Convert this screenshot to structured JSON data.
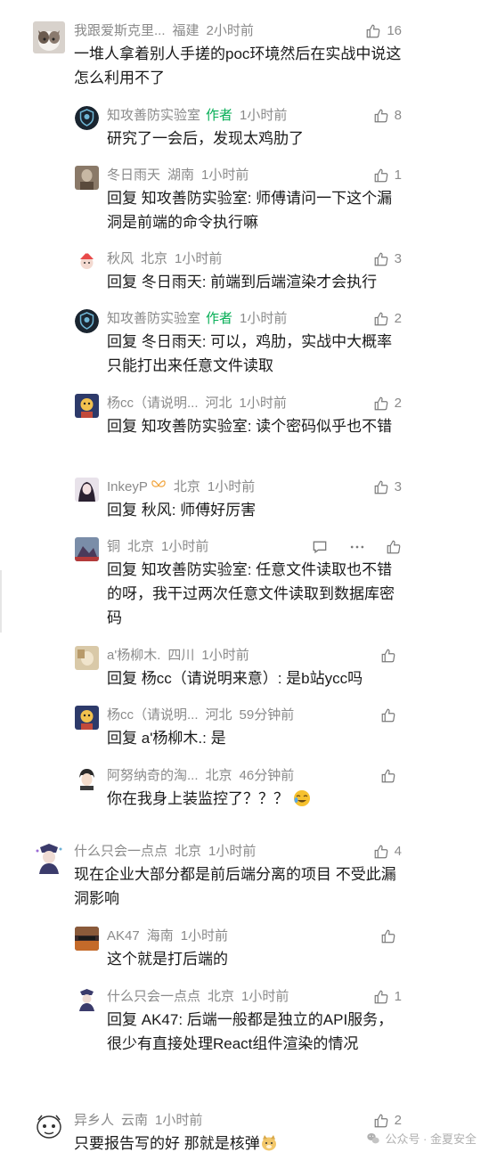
{
  "comments": [
    {
      "name": "我跟爱斯克里...",
      "author": "",
      "loc": "福建",
      "time": "2小时前",
      "likes": "16",
      "text": "一堆人拿着别人手搓的poc环境然后在实战中说这怎么利用不了"
    },
    {
      "name": "知攻善防实验室",
      "author": "作者",
      "loc": "",
      "time": "1小时前",
      "likes": "8",
      "text": "研究了一会后，发现太鸡肋了"
    },
    {
      "name": "冬日雨天",
      "author": "",
      "loc": "湖南",
      "time": "1小时前",
      "likes": "1",
      "prefix": "回复",
      "target": "知攻善防实验室",
      "text": ": 师傅请问一下这个漏洞是前端的命令执行嘛"
    },
    {
      "name": "秋风",
      "author": "",
      "loc": "北京",
      "time": "1小时前",
      "likes": "3",
      "prefix": "回复",
      "target": "冬日雨天",
      "text": ": 前端到后端渲染才会执行"
    },
    {
      "name": "知攻善防实验室",
      "author": "作者",
      "loc": "",
      "time": "1小时前",
      "likes": "2",
      "prefix": "回复",
      "target": "冬日雨天",
      "text": ": 可以，鸡肋，实战中大概率只能打出来任意文件读取"
    },
    {
      "name": "杨cc（请说明...",
      "author": "",
      "loc": "河北",
      "time": "1小时前",
      "likes": "2",
      "prefix": "回复",
      "target": "知攻善防实验室",
      "text": ": 读个密码似乎也不错"
    },
    {
      "name": "InkeyP",
      "author": "",
      "loc": "北京",
      "time": "1小时前",
      "likes": "3",
      "prefix": "回复",
      "target": "秋风",
      "text": ": 师傅好厉害"
    },
    {
      "name": "铜",
      "author": "",
      "loc": "北京",
      "time": "1小时前",
      "likes": "",
      "prefix": "回复",
      "target": "知攻善防实验室",
      "text": ": 任意文件读取也不错的呀，我干过两次任意文件读取到数据库密码"
    },
    {
      "name": "a'杨柳木.",
      "author": "",
      "loc": "四川",
      "time": "1小时前",
      "likes": "",
      "prefix": "回复",
      "target": "杨cc（请说明来意）",
      "text": ": 是b站ycc吗"
    },
    {
      "name": "杨cc（请说明...",
      "author": "",
      "loc": "河北",
      "time": "59分钟前",
      "likes": "",
      "prefix": "回复",
      "target": "a'杨柳木.",
      "text": ": 是"
    },
    {
      "name": "阿努纳奇的淘...",
      "author": "",
      "loc": "北京",
      "time": "46分钟前",
      "likes": "",
      "text": "你在我身上装监控了？？？"
    },
    {
      "name": "什么只会一点点",
      "author": "",
      "loc": "北京",
      "time": "1小时前",
      "likes": "4",
      "text": "现在企业大部分都是前后端分离的项目 不受此漏洞影响"
    },
    {
      "name": "AK47",
      "author": "",
      "loc": "海南",
      "time": "1小时前",
      "likes": "",
      "text": "这个就是打后端的"
    },
    {
      "name": "什么只会一点点",
      "author": "",
      "loc": "北京",
      "time": "1小时前",
      "likes": "1",
      "prefix": "回复",
      "target": "AK47",
      "text": ": 后端一般都是独立的API服务，很少有直接处理React组件渲染的情况"
    },
    {
      "name": "异乡人",
      "author": "",
      "loc": "云南",
      "time": "1小时前",
      "likes": "2",
      "text": "只要报告写的好  那就是核弹"
    }
  ],
  "watermark": "公众号 · 金夏安全",
  "colors": {
    "text": "#1a1a1a",
    "meta": "#8a8a8a",
    "author": "#06ae56"
  },
  "icons": [
    "thumbs-up-icon",
    "comment-icon",
    "more-icon",
    "wechat-icon"
  ]
}
